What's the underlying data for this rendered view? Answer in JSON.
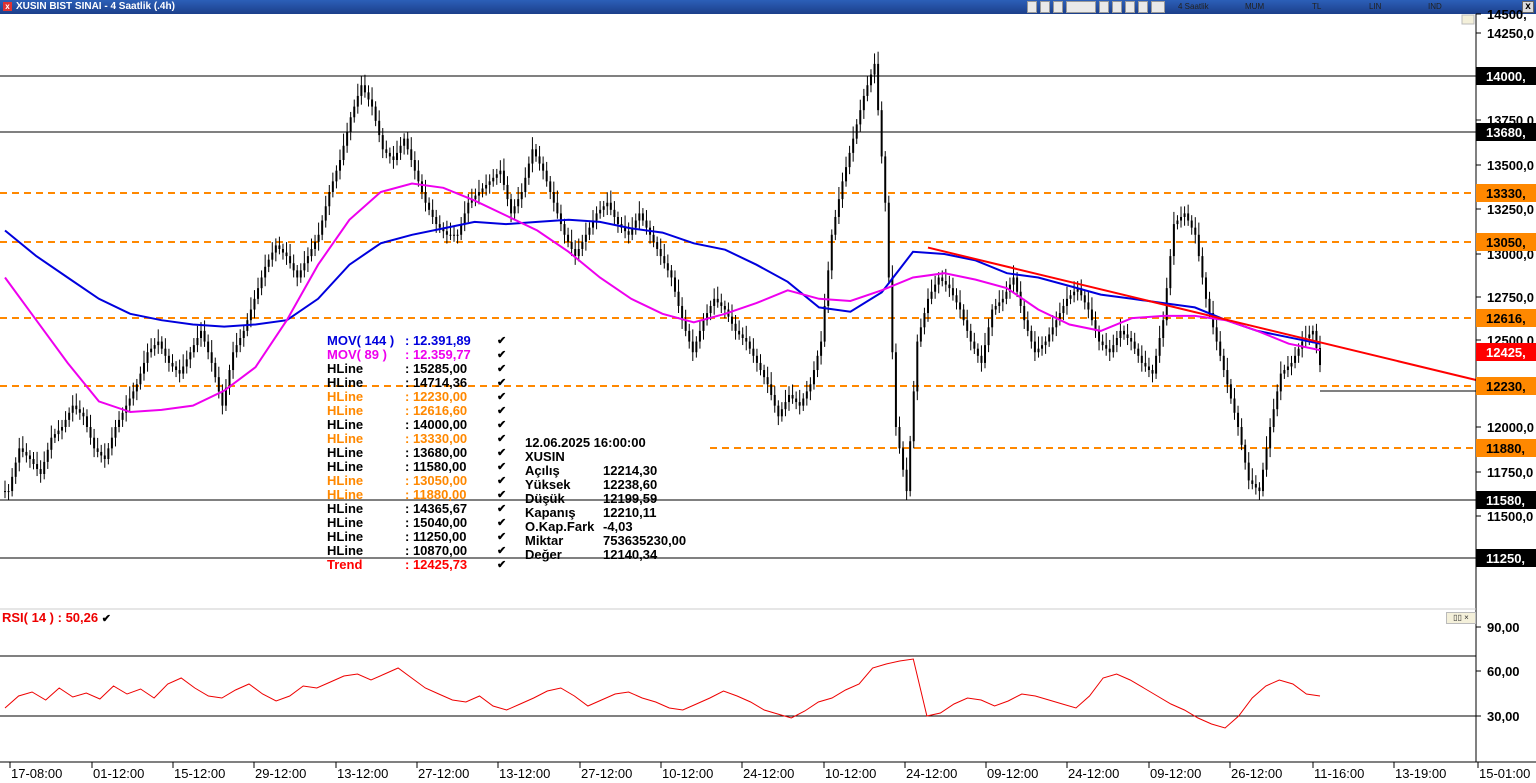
{
  "window": {
    "title": "XUSIN BIST SINAI - 4 Saatlik (.4h)",
    "toolbar": {
      "period": "4 Saatlik",
      "style": "MUM",
      "currency": "TL",
      "scale": "LIN",
      "indicator": "IND"
    },
    "close_label": "x"
  },
  "price_axis": {
    "ticks": [
      "14500,",
      "14250,0",
      "13750,0",
      "13500,0",
      "13250,0",
      "13000,0",
      "12750,0",
      "12500,0",
      "12000,0",
      "11750,0",
      "11500,0"
    ],
    "tags": [
      {
        "label": "14000,",
        "price": 14000,
        "kind": "black"
      },
      {
        "label": "13680,",
        "price": 13680,
        "kind": "black"
      },
      {
        "label": "13330,",
        "price": 13330,
        "kind": "orange"
      },
      {
        "label": "13050,",
        "price": 13050,
        "kind": "orange"
      },
      {
        "label": "12616,",
        "price": 12616.6,
        "kind": "orange"
      },
      {
        "label": "12425,",
        "price": 12425.73,
        "kind": "red"
      },
      {
        "label": "12230,",
        "price": 12230,
        "kind": "orange"
      },
      {
        "label": "11880,",
        "price": 11880,
        "kind": "orange"
      },
      {
        "label": "11580,",
        "price": 11580,
        "kind": "black"
      },
      {
        "label": "11250,",
        "price": 11250,
        "kind": "black"
      }
    ]
  },
  "time_axis": [
    "17-08:00",
    "01-12:00",
    "15-12:00",
    "29-12:00",
    "13-12:00",
    "27-12:00",
    "13-12:00",
    "27-12:00",
    "10-12:00",
    "24-12:00",
    "10-12:00",
    "24-12:00",
    "09-12:00",
    "24-12:00",
    "09-12:00",
    "26-12:00",
    "11-16:00",
    "13-19:00",
    "15-01:00"
  ],
  "legend": [
    {
      "name": "MOV( 144 )",
      "value": ": 12.391,89",
      "color": "#0000dd"
    },
    {
      "name": "MOV( 89 )",
      "value": ": 12.359,77",
      "color": "#ee00ee"
    },
    {
      "name": "HLine",
      "value": ": 15285,00",
      "color": "#000000"
    },
    {
      "name": "HLine",
      "value": ": 14714,36",
      "color": "#000000"
    },
    {
      "name": "HLine",
      "value": ": 12230,00",
      "color": "#ff8800"
    },
    {
      "name": "HLine",
      "value": ": 12616,60",
      "color": "#ff8800"
    },
    {
      "name": "HLine",
      "value": ": 14000,00",
      "color": "#000000"
    },
    {
      "name": "HLine",
      "value": ": 13330,00",
      "color": "#ff8800"
    },
    {
      "name": "HLine",
      "value": ": 13680,00",
      "color": "#000000"
    },
    {
      "name": "HLine",
      "value": ": 11580,00",
      "color": "#000000"
    },
    {
      "name": "HLine",
      "value": ": 13050,00",
      "color": "#ff8800"
    },
    {
      "name": "HLine",
      "value": ": 11880,00",
      "color": "#ff8800"
    },
    {
      "name": "HLine",
      "value": ": 14365,67",
      "color": "#000000"
    },
    {
      "name": "HLine",
      "value": ": 15040,00",
      "color": "#000000"
    },
    {
      "name": "HLine",
      "value": ": 11250,00",
      "color": "#000000"
    },
    {
      "name": "HLine",
      "value": ": 10870,00",
      "color": "#000000"
    },
    {
      "name": "Trend",
      "value": ": 12425,73",
      "color": "#ff0000"
    }
  ],
  "info_box": {
    "datetime": "12.06.2025  16:00:00",
    "symbol": "XUSIN",
    "rows": [
      {
        "key": "Açılış",
        "value": "12214,30"
      },
      {
        "key": "Yüksek",
        "value": "12238,60"
      },
      {
        "key": "Düşük",
        "value": "12199,59"
      },
      {
        "key": "Kapanış",
        "value": "12210,11"
      },
      {
        "key": "O.Kap.Fark",
        "value": "-4,03"
      },
      {
        "key": "Miktar",
        "value": "753635230,00"
      },
      {
        "key": "Değer",
        "value": "12140,34"
      }
    ]
  },
  "rsi": {
    "label": "RSI( 14 )",
    "value": ":  50,26",
    "ticks": [
      "90,00",
      "60,00",
      "30,00"
    ],
    "levels": [
      70,
      30
    ]
  },
  "chart_data": [
    {
      "type": "candlestick",
      "title": "XUSIN BIST SINAI - 4 Saatlik (.4h)",
      "ylim": [
        11250,
        14500
      ],
      "x_ticks": [
        "17-08:00",
        "01-12:00",
        "15-12:00",
        "29-12:00",
        "13-12:00",
        "27-12:00",
        "13-12:00",
        "27-12:00",
        "10-12:00",
        "24-12:00",
        "10-12:00",
        "24-12:00",
        "09-12:00",
        "24-12:00",
        "09-12:00",
        "26-12:00",
        "11-16:00",
        "13-19:00",
        "15-01:00"
      ],
      "series": [
        {
          "name": "Close",
          "values": [
            11700,
            11900,
            11850,
            11780,
            11950,
            12000,
            12100,
            12050,
            11900,
            11850,
            12000,
            12100,
            12200,
            12350,
            12400,
            12300,
            12250,
            12350,
            12450,
            12300,
            12100,
            12350,
            12450,
            12600,
            12750,
            12850,
            12800,
            12700,
            12800,
            12900,
            13100,
            13250,
            13450,
            13600,
            13500,
            13300,
            13250,
            13350,
            13200,
            13050,
            12950,
            12900,
            12900,
            13050,
            13100,
            13150,
            13200,
            13000,
            13100,
            13300,
            13200,
            13050,
            12900,
            12800,
            12900,
            13000,
            13050,
            12950,
            12900,
            13000,
            12900,
            12800,
            12700,
            12500,
            12350,
            12500,
            12600,
            12550,
            12450,
            12400,
            12300,
            12200,
            12050,
            12150,
            12100,
            12200,
            12400,
            12900,
            13150,
            13350,
            13550,
            13700,
            13050,
            12000,
            11700,
            12400,
            12600,
            12700,
            12650,
            12550,
            12400,
            12300,
            12550,
            12600,
            12700,
            12500,
            12350,
            12400,
            12500,
            12600,
            12650,
            12550,
            12400,
            12350,
            12450,
            12400,
            12300,
            12250,
            12500,
            12950,
            13000,
            12900,
            12600,
            12400,
            12200,
            12000,
            11750,
            11700,
            12000,
            12250,
            12300,
            12400,
            12450,
            12210
          ]
        },
        {
          "name": "MOV( 144 )",
          "values": [
            12920,
            12800,
            12700,
            12600,
            12530,
            12500,
            12480,
            12470,
            12480,
            12500,
            12600,
            12760,
            12860,
            12900,
            12930,
            12960,
            12950,
            12960,
            12970,
            12960,
            12930,
            12910,
            12860,
            12830,
            12760,
            12680,
            12560,
            12540,
            12630,
            12820,
            12810,
            12780,
            12720,
            12700,
            12660,
            12620,
            12600,
            12580,
            12560,
            12500,
            12450,
            12420,
            12390
          ]
        },
        {
          "name": "MOV( 89 )",
          "values": [
            12700,
            12500,
            12300,
            12120,
            12070,
            12080,
            12100,
            12170,
            12280,
            12500,
            12760,
            12970,
            13100,
            13140,
            13120,
            13060,
            12990,
            12920,
            12820,
            12700,
            12600,
            12530,
            12490,
            12530,
            12580,
            12640,
            12600,
            12590,
            12640,
            12700,
            12720,
            12690,
            12650,
            12550,
            12480,
            12450,
            12510,
            12520,
            12520,
            12500,
            12450,
            12390,
            12360
          ]
        },
        {
          "name": "Trend",
          "values": [
            12840,
            12220
          ]
        }
      ]
    },
    {
      "type": "line",
      "title": "RSI( 14 )",
      "ylim": [
        0,
        100
      ],
      "series": [
        {
          "name": "RSI( 14 )",
          "values": [
            38,
            50,
            54,
            46,
            58,
            49,
            53,
            47,
            60,
            52,
            57,
            48,
            62,
            68,
            58,
            50,
            48,
            56,
            62,
            52,
            45,
            50,
            60,
            58,
            64,
            70,
            72,
            66,
            72,
            78,
            68,
            58,
            52,
            46,
            44,
            50,
            40,
            36,
            42,
            48,
            55,
            58,
            50,
            40,
            46,
            52,
            54,
            48,
            44,
            38,
            36,
            42,
            48,
            55,
            50,
            44,
            36,
            32,
            28,
            35,
            44,
            48,
            56,
            62,
            78,
            82,
            85,
            87,
            30,
            33,
            42,
            48,
            46,
            40,
            45,
            52,
            50,
            46,
            42,
            38,
            50,
            68,
            72,
            66,
            58,
            50,
            42,
            36,
            28,
            22,
            18,
            30,
            48,
            60,
            66,
            62,
            52,
            50
          ]
        }
      ]
    }
  ]
}
